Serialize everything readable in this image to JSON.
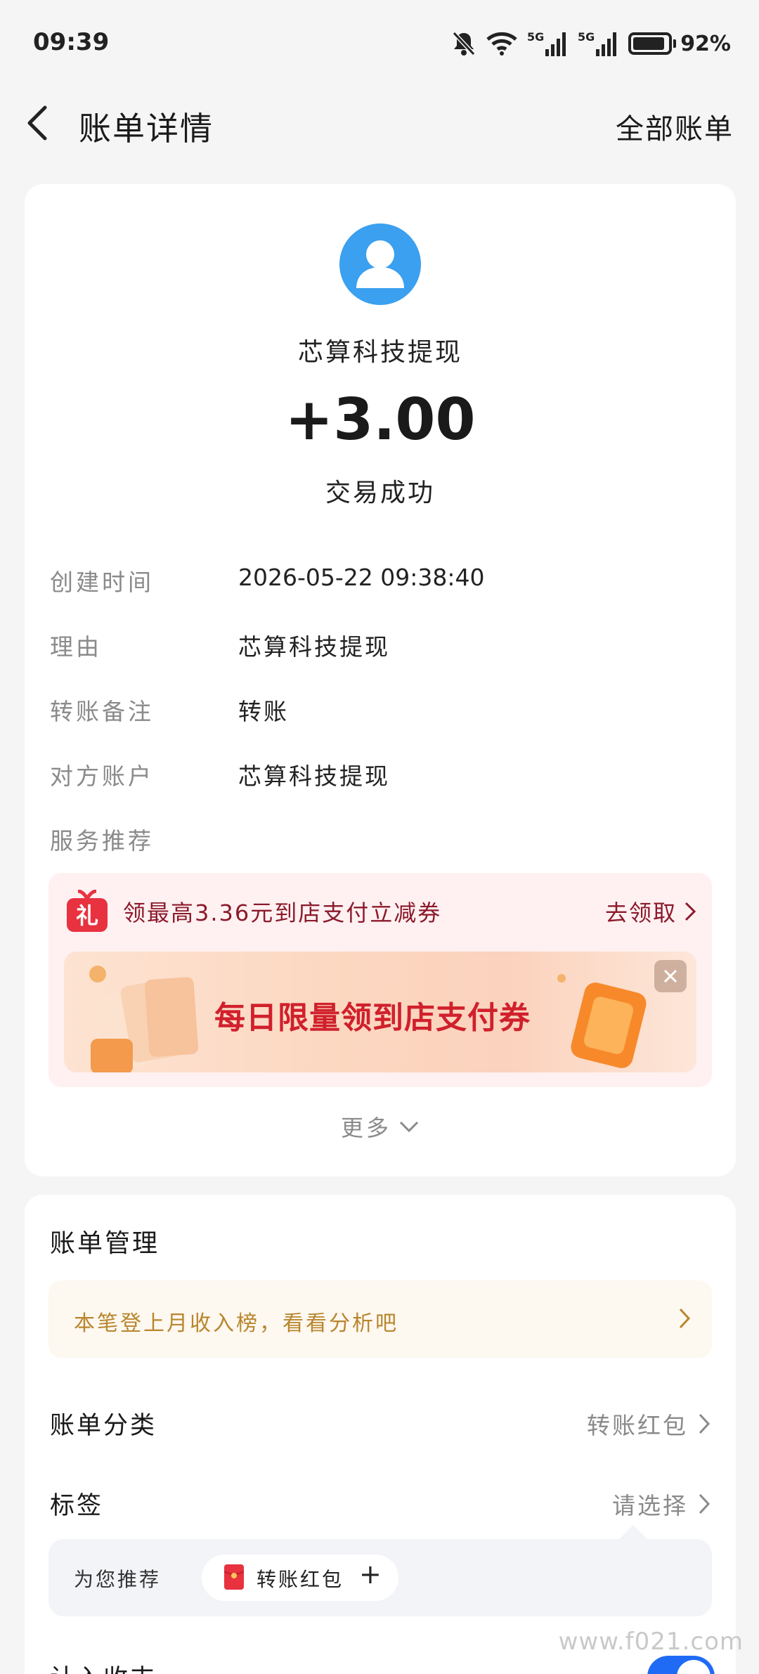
{
  "status_bar": {
    "time": "09:39",
    "battery": "92%",
    "battery_level": 0.92,
    "network_1": "5G",
    "network_2": "5G"
  },
  "nav": {
    "title": "账单详情",
    "right_link": "全部账单"
  },
  "transaction": {
    "payer": "芯算科技提现",
    "amount": "+3.00",
    "status": "交易成功",
    "details": [
      {
        "label": "创建时间",
        "value": "2026-05-22 09:38:40"
      },
      {
        "label": "理由",
        "value": "芯算科技提现"
      },
      {
        "label": "转账备注",
        "value": "转账"
      },
      {
        "label": "对方账户",
        "value": "芯算科技提现"
      },
      {
        "label": "服务推荐",
        "value": ""
      }
    ]
  },
  "promo": {
    "icon": "gift-icon",
    "text": "领最高3.36元到店支付立减券",
    "link": "去领取",
    "banner_text": "每日限量领到店支付券"
  },
  "more_label": "更多",
  "manage": {
    "title": "账单管理",
    "insight": "本笔登上月收入榜，看看分析吧",
    "category_label": "账单分类",
    "category_value": "转账红包",
    "tag_label": "标签",
    "tag_value": "请选择",
    "suggest_label": "为您推荐",
    "suggest_chip": "转账红包",
    "suggest_plus": "+",
    "partial_label": "计入收支",
    "toggle_on": true
  },
  "watermark": "www.f021.com",
  "colors": {
    "accent_blue": "#1f6bf5",
    "avatar_blue": "#3aa0ef",
    "promo_red": "#8b1a2b",
    "insight_gold": "#b8862d"
  }
}
